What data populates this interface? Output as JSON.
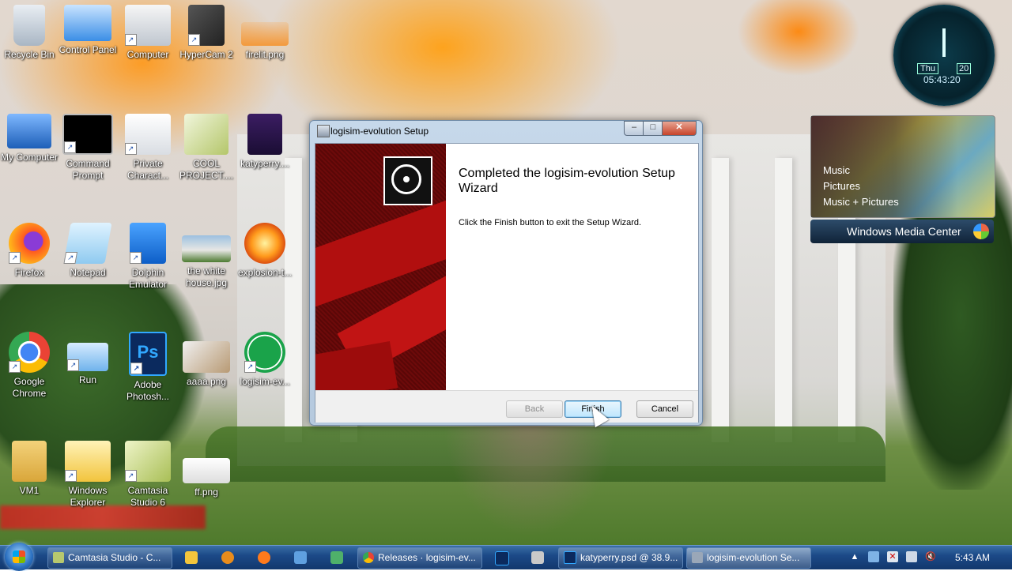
{
  "desktop": {
    "icons": [
      {
        "label": "Recycle Bin",
        "icon": "recycle-bin-icon"
      },
      {
        "label": "Control Panel",
        "icon": "control-panel-icon"
      },
      {
        "label": "Computer",
        "icon": "computer-icon"
      },
      {
        "label": "HyperCam 2",
        "icon": "hypercam-icon"
      },
      {
        "label": "firelit.png",
        "icon": "image-file-icon"
      },
      {
        "label": "My Computer",
        "icon": "my-computer-icon"
      },
      {
        "label": "Command Prompt",
        "icon": "command-prompt-icon"
      },
      {
        "label": "Private Charact...",
        "icon": "private-character-icon"
      },
      {
        "label": "COOL PROJECT....",
        "icon": "project-file-icon"
      },
      {
        "label": "katyperry....",
        "icon": "firefox-file-icon"
      },
      {
        "label": "Firefox",
        "icon": "firefox-icon"
      },
      {
        "label": "Notepad",
        "icon": "notepad-icon"
      },
      {
        "label": "Dolphin Emulator",
        "icon": "dolphin-emulator-icon"
      },
      {
        "label": "the white house.jpg",
        "icon": "image-file-icon"
      },
      {
        "label": "explosion-t...",
        "icon": "image-file-icon"
      },
      {
        "label": "Google Chrome",
        "icon": "chrome-icon"
      },
      {
        "label": "Run",
        "icon": "run-icon"
      },
      {
        "label": "Adobe Photosh...",
        "icon": "photoshop-icon"
      },
      {
        "label": "aaaa.png",
        "icon": "image-file-icon"
      },
      {
        "label": "logisim-ev...",
        "icon": "logisim-icon"
      },
      {
        "label": "VM1",
        "icon": "user-folder-icon"
      },
      {
        "label": "Windows Explorer",
        "icon": "windows-explorer-icon"
      },
      {
        "label": "Camtasia Studio 6",
        "icon": "camtasia-icon"
      },
      {
        "label": "ff.png",
        "icon": "image-file-icon"
      }
    ]
  },
  "gadgets": {
    "clock": {
      "day": "Thu",
      "date": "20",
      "time": "05:43:20"
    },
    "media_center": {
      "items": [
        "Music",
        "Pictures",
        "Music + Pictures"
      ],
      "brand": "Windows Media Center"
    }
  },
  "dialog": {
    "title": "logisim-evolution Setup",
    "controls": {
      "minimize": "–",
      "maximize": "□",
      "close": "✕"
    },
    "heading": "Completed the logisim-evolution Setup Wizard",
    "message": "Click the Finish button to exit the Setup Wizard.",
    "buttons": {
      "back": "Back",
      "finish": "Finish",
      "cancel": "Cancel"
    }
  },
  "taskbar": {
    "items": [
      {
        "label": "Camtasia Studio - C...",
        "icon": "camtasia-icon",
        "color": "#b7c86e"
      },
      {
        "label": "Releases · logisim-ev...",
        "icon": "chrome-icon",
        "color": "#e0453a"
      },
      {
        "label": "katyperry.psd @ 38.9...",
        "icon": "photoshop-icon",
        "color": "#0b2a5e"
      },
      {
        "label": "logisim-evolution Se...",
        "icon": "setup-icon",
        "color": "#9aa7b8"
      }
    ],
    "quick_launch": [
      {
        "icon": "windows-explorer-icon",
        "color": "#f3c53c"
      },
      {
        "icon": "media-player-icon",
        "color": "#e98c1c"
      },
      {
        "icon": "firefox-icon",
        "color": "#ff7a1c"
      },
      {
        "icon": "program-icon",
        "color": "#5fa0e0"
      },
      {
        "icon": "network-icon",
        "color": "#4fb06a"
      },
      {
        "icon": "photoshop-icon",
        "color": "#0b2a5e"
      },
      {
        "icon": "tool-icon",
        "color": "#c9c9c9"
      }
    ],
    "tray": {
      "time": "5:43 AM"
    }
  }
}
